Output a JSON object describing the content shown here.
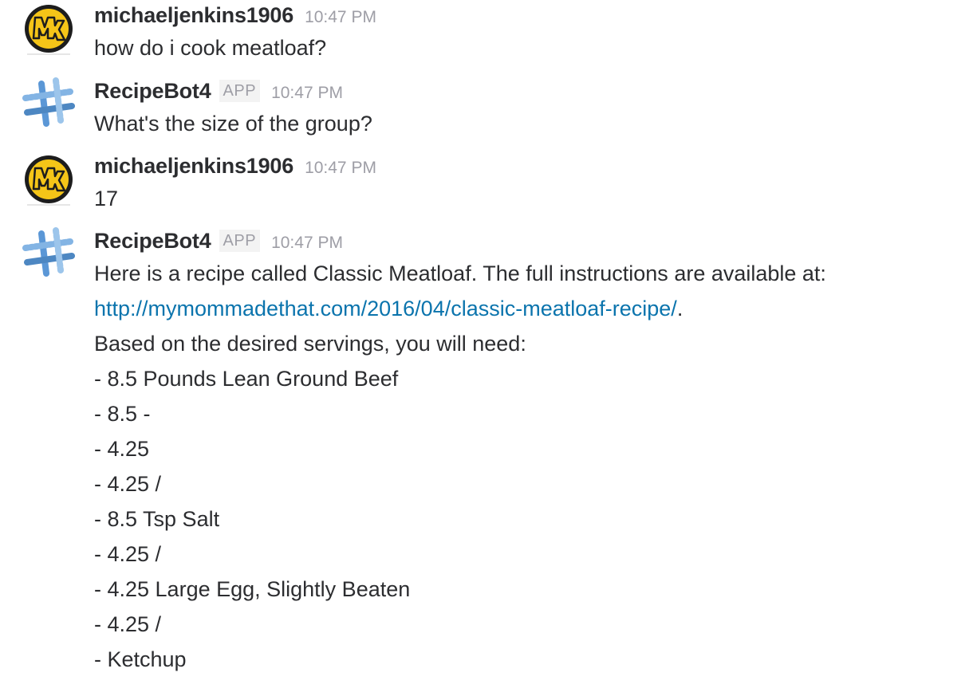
{
  "messages": [
    {
      "user": "michaeljenkins1906",
      "avatar_icon": "mk-logo-avatar",
      "timestamp": "10:47 PM",
      "lines": [
        "how do i cook meatloaf?"
      ]
    },
    {
      "user": "RecipeBot4",
      "avatar_icon": "slack-hash-avatar",
      "badge": "APP",
      "timestamp": "10:47 PM",
      "lines": [
        "What's the size of the group?"
      ]
    },
    {
      "user": "michaeljenkins1906",
      "avatar_icon": "mk-logo-avatar",
      "timestamp": "10:47 PM",
      "lines": [
        "17"
      ]
    },
    {
      "user": "RecipeBot4",
      "avatar_icon": "slack-hash-avatar",
      "badge": "APP",
      "timestamp": "10:47 PM",
      "lines": [
        "Here is a recipe called Classic Meatloaf. The full instructions are available at:",
        "Based on the desired servings, you will need:",
        "- 8.5 Pounds Lean Ground Beef",
        "- 8.5 -",
        "- 4.25",
        "- 4.25 /",
        "- 8.5 Tsp Salt",
        "- 4.25 /",
        "- 4.25 Large Egg, Slightly Beaten",
        "- 4.25 /",
        "- Ketchup"
      ],
      "link_text": "http://mymommadethat.com/2016/04/classic-meatloaf-recipe/",
      "link_suffix": "."
    }
  ],
  "colors": {
    "text": "#2c2d30",
    "muted": "#9e9ea6",
    "link": "#0b74ad",
    "mk_yellow": "#f5c518",
    "hash_blue": "#3f86cf"
  }
}
